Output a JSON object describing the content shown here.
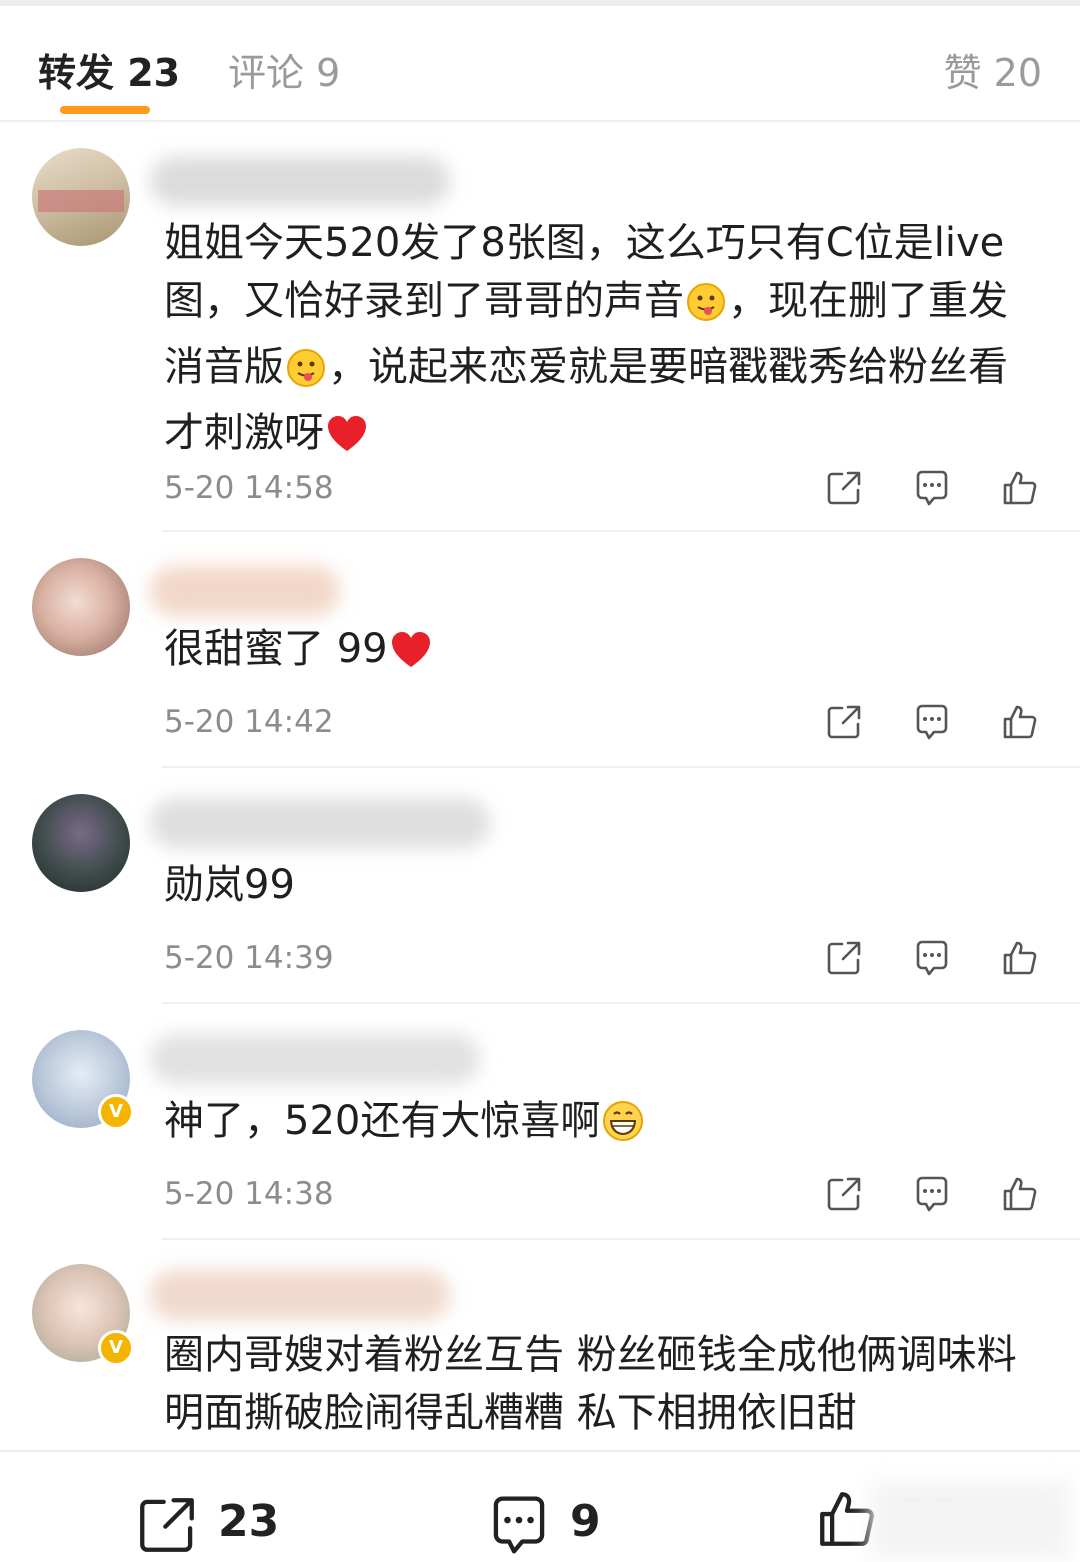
{
  "tabs": {
    "repost": "转发 23",
    "comments": "评论 9",
    "likes": "赞 20"
  },
  "comments": [
    {
      "text_parts": [
        "姐姐今天520发了8张图，这么巧只有C位是live图，又恰好录到了哥哥的声音",
        "，现在删了重发消音版",
        "，说起来恋爱就是要暗戳戳秀给粉丝看才刺激呀"
      ],
      "time": "5-20 14:58",
      "verified": false
    },
    {
      "text_parts": [
        "很甜蜜了 99"
      ],
      "time": "5-20 14:42",
      "verified": false
    },
    {
      "text_parts": [
        "勋岚99"
      ],
      "time": "5-20 14:39",
      "verified": false
    },
    {
      "text_parts": [
        "神了，520还有大惊喜啊"
      ],
      "time": "5-20 14:38",
      "verified": true
    },
    {
      "text_parts": [
        "圈内哥嫂对着粉丝互告 粉丝砸钱全成他俩调味料 明面撕破脸闹得乱糟糟 私下相拥依旧甜"
      ],
      "time": "",
      "verified": true
    }
  ],
  "icons": {
    "share": "share-icon",
    "comment": "comment-icon",
    "like": "thumbs-up-icon",
    "verified": "verified-badge-icon",
    "emoji_tongue": "tongue-emoji-icon",
    "emoji_heart": "red-heart-icon",
    "emoji_grin": "grin-emoji-icon"
  },
  "colors": {
    "accent_underline": "#ff9b1a",
    "heart": "#e8202a",
    "verified": "#f5b400"
  },
  "bottom_bar": {
    "repost_count": "23",
    "comment_count": "9",
    "like_count": "20"
  }
}
